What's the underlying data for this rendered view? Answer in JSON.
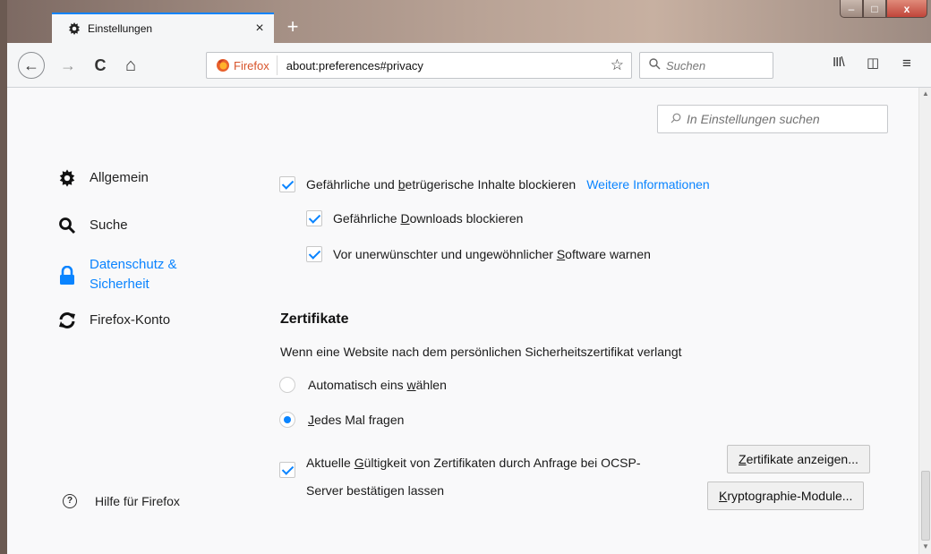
{
  "tab": {
    "title": "Einstellungen",
    "close": "×",
    "newtab": "+"
  },
  "window_controls": {
    "minimize": "–",
    "maximize": "□",
    "close": "x"
  },
  "nav": {
    "back": "←",
    "forward": "→",
    "reload": "C",
    "home": "⌂",
    "identity_label": "Firefox",
    "url": "about:preferences#privacy",
    "bookmark_star": "☆",
    "search_placeholder": "Suchen",
    "library": "III\\",
    "sidebar": "◫",
    "menu": "≡"
  },
  "pref_search": {
    "placeholder": "In Einstellungen suchen"
  },
  "categories": [
    {
      "label": "Allgemein",
      "icon": "gear-icon"
    },
    {
      "label": "Suche",
      "icon": "search-icon"
    },
    {
      "label1": "Datenschutz &",
      "label2": "Sicherheit",
      "icon": "lock-icon",
      "active": true
    },
    {
      "label": "Firefox-Konto",
      "icon": "sync-icon"
    }
  ],
  "help": {
    "label": "Hilfe für Firefox",
    "icon": "?"
  },
  "options": {
    "block_dangerous_pre": "Gefährliche und ",
    "block_dangerous_accel": "b",
    "block_dangerous_post": "etrügerische Inhalte blockieren",
    "more_info": "Weitere Informationen",
    "block_downloads_pre": "Gefährliche ",
    "block_downloads_accel": "D",
    "block_downloads_post": "ownloads blockieren",
    "warn_software_pre": "Vor unerwünschter und ungewöhnlicher ",
    "warn_software_accel": "S",
    "warn_software_post": "oftware warnen"
  },
  "certificates": {
    "title": "Zertifikate",
    "description": "Wenn eine Website nach dem persönlichen Sicherheitszertifikat verlangt",
    "auto_pre": "Automatisch eins ",
    "auto_accel": "w",
    "auto_post": "ählen",
    "ask_accel": "J",
    "ask_post": "edes Mal fragen",
    "ocsp_line1_pre": "Aktuelle ",
    "ocsp_line1_accel": "G",
    "ocsp_line1_post": "ültigkeit von Zertifikaten durch Anfrage bei OCSP-",
    "ocsp_line2": "Server bestätigen lassen",
    "view_btn_accel": "Z",
    "view_btn_post": "ertifikate anzeigen...",
    "crypto_btn_accel": "K",
    "crypto_btn_post": "ryptographie-Module..."
  },
  "state": {
    "block_dangerous": true,
    "block_downloads": true,
    "warn_software": true,
    "cert_mode": "ask",
    "ocsp": true
  },
  "colors": {
    "accent": "#0a84ff",
    "firefox_orange": "#d7532a"
  }
}
